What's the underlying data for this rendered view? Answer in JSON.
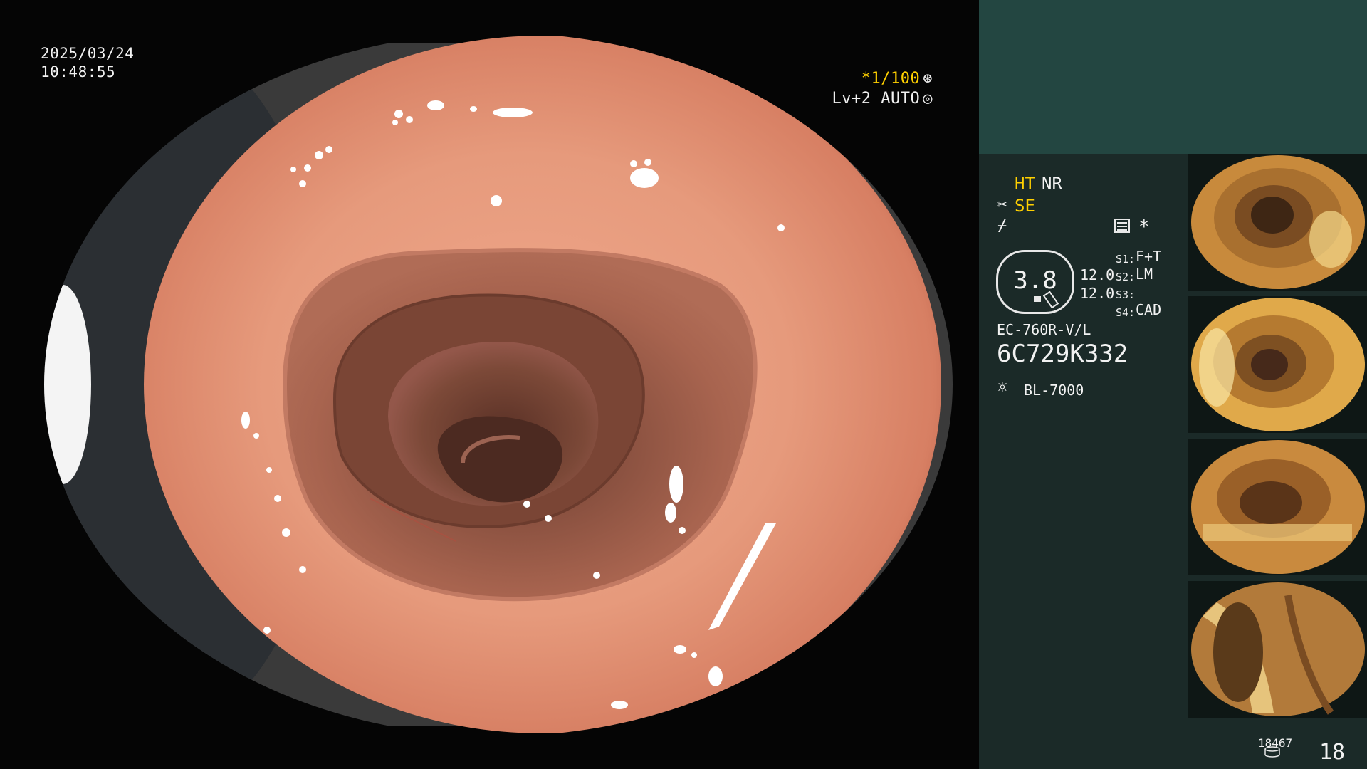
{
  "osd": {
    "date": "2025/03/24",
    "time": "10:48:55",
    "shutter": "*1/100",
    "shutter_icon": "aperture-icon",
    "level": "Lv+2 AUTO",
    "level_icon": "auto-iris-icon"
  },
  "panel": {
    "ht": "HT",
    "nr": "NR",
    "se": "SE",
    "asterisk": "*",
    "gauge_value": "3.8",
    "val_top": "12.0",
    "val_bottom": "12.0",
    "s1_label": "S1:",
    "s1_value": "F+T",
    "s2_label": "S2:",
    "s2_value": "LM",
    "s3_label": "S3:",
    "s4_label": "S4:",
    "s4_value": "CAD",
    "scope_model": "EC-760R-V/L",
    "scope_serial": "6C729K332",
    "light_source": "BL-7000",
    "counter_small": "18467",
    "counter_large": "18"
  },
  "colors": {
    "panel_bg": "#1b2a28",
    "panel_header": "#234641",
    "accent_yellow": "#ffd000",
    "mucosa": "#d9866e"
  }
}
